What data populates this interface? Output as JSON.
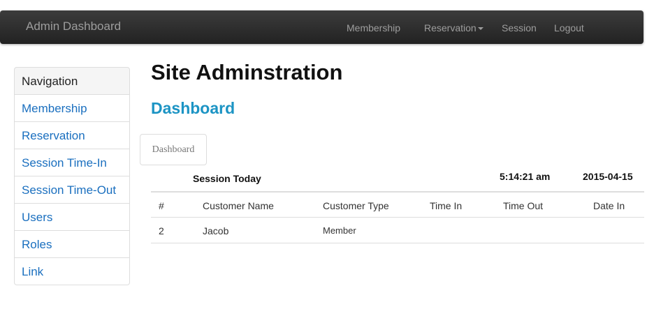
{
  "navbar": {
    "brand": "Admin Dashboard",
    "links": [
      {
        "label": "Membership"
      },
      {
        "label": "Reservation",
        "dropdown": true
      },
      {
        "label": "Session"
      },
      {
        "label": "Logout"
      }
    ]
  },
  "sidebar": {
    "header": "Navigation",
    "items": [
      {
        "label": "Membership"
      },
      {
        "label": "Reservation"
      },
      {
        "label": "Session Time-In"
      },
      {
        "label": "Session Time-Out"
      },
      {
        "label": "Users"
      },
      {
        "label": "Roles"
      },
      {
        "label": "Link"
      }
    ]
  },
  "main": {
    "title": "Site Adminstration",
    "section_title": "Dashboard",
    "tab_label": "Dashboard",
    "session_label": "Session Today",
    "time": "5:14:21 am",
    "date": "2015-04-15",
    "table": {
      "columns": [
        "#",
        "Customer Name",
        "Customer Type",
        "Time In",
        "Time Out",
        "Date In"
      ],
      "rows": [
        [
          "2",
          "Jacob",
          "Member",
          "",
          "",
          ""
        ]
      ]
    }
  },
  "colors": {
    "navbar_bg": "#2a2a2a",
    "nav_text": "#9d9d9d",
    "link": "#1a6fbf",
    "section_title": "#1c94c4"
  }
}
